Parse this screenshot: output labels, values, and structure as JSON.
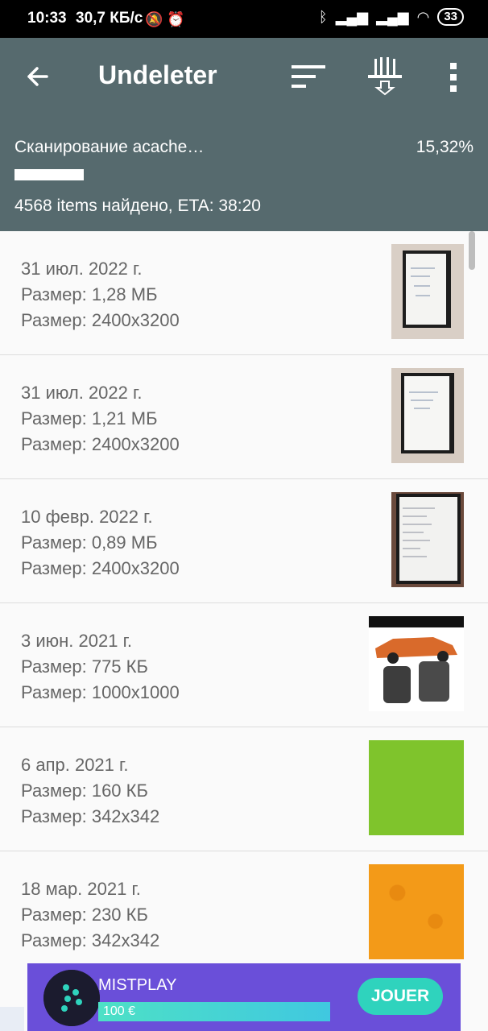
{
  "statusbar": {
    "time": "10:33",
    "speed": "30,7 КБ/с",
    "battery": "33"
  },
  "appbar": {
    "title": "Undeleter"
  },
  "scan": {
    "status": "Сканирование acache…",
    "percent": "15,32%",
    "progress": 0.1532,
    "found": "4568 items найдено, ETA: 38:20"
  },
  "items": [
    {
      "date": "31 июл. 2022 г.",
      "size": "Размер: 1,28 МБ",
      "dims": "Размер: 2400x3200",
      "thumb": "notebook-photo"
    },
    {
      "date": "31 июл. 2022 г.",
      "size": "Размер: 1,21 МБ",
      "dims": "Размер: 2400x3200",
      "thumb": "notebook-photo"
    },
    {
      "date": "10 февр. 2022 г.",
      "size": "Размер: 0,89 МБ",
      "dims": "Размер: 2400x3200",
      "thumb": "notebook-photo"
    },
    {
      "date": "3 июн. 2021 г.",
      "size": "Размер: 775 КБ",
      "dims": "Размер: 1000x1000",
      "thumb": "car-photo"
    },
    {
      "date": "6 апр. 2021 г.",
      "size": "Размер: 160 КБ",
      "dims": "Размер: 342x342",
      "thumb": "green-pattern"
    },
    {
      "date": "18 мар. 2021 г.",
      "size": "Размер: 230 КБ",
      "dims": "Размер: 342x342",
      "thumb": "orange-pattern"
    }
  ],
  "ad": {
    "name": "MISTPLAY",
    "bar_label": "100 €",
    "button": "JOUER"
  },
  "colors": {
    "appbar": "#566a6e",
    "green": "#7fc42c",
    "orange": "#f39a18",
    "ad": "#6a4fd9"
  }
}
